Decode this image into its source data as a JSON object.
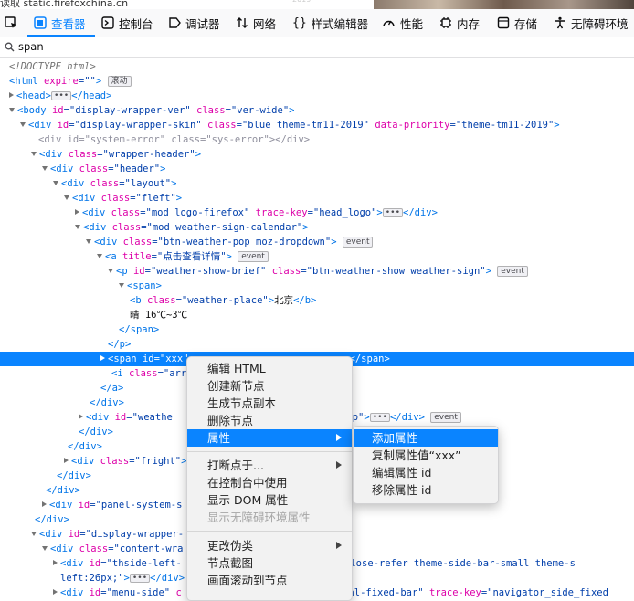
{
  "status": {
    "url": "读取 static.firefoxchina.cn",
    "faint_text": "2019"
  },
  "toolbar": {
    "tabs": [
      {
        "label": "查看器"
      },
      {
        "label": "控制台"
      },
      {
        "label": "调试器"
      },
      {
        "label": "网络"
      },
      {
        "label": "样式编辑器"
      },
      {
        "label": "性能"
      },
      {
        "label": "内存"
      },
      {
        "label": "存储"
      },
      {
        "label": "无障碍环境"
      }
    ]
  },
  "search": {
    "value": "span"
  },
  "tree": {
    "l0": {
      "t": "<!DOCTYPE html>"
    },
    "l1": {
      "a": "<html ",
      "b": "expire",
      "c": "=\"\"",
      "d": ">",
      "badge": "滚动"
    },
    "l2": {
      "a": "<head>",
      "b": "</head>"
    },
    "l3": {
      "a": "<body ",
      "b": "id",
      "c": "=\"display-wrapper-ver\" ",
      "d": "class",
      "e": "=\"ver-wide\"",
      "f": ">"
    },
    "l4": {
      "a": "<div ",
      "b": "id",
      "c": "=\"display-wrapper-skin\" ",
      "d": "class",
      "e": "=\"blue theme-tm11-2019\" ",
      "f": "data-priority",
      "g": "=\"theme-tm11-2019\"",
      "h": ">"
    },
    "l5": {
      "t": "<div id=\"system-error\" class=\"sys-error\"></div>"
    },
    "l6": {
      "a": "<div ",
      "b": "class",
      "c": "=\"wrapper-header\"",
      "d": ">"
    },
    "l7": {
      "a": "<div ",
      "b": "class",
      "c": "=\"header\"",
      "d": ">"
    },
    "l8": {
      "a": "<div ",
      "b": "class",
      "c": "=\"layout\"",
      "d": ">"
    },
    "l9": {
      "a": "<div ",
      "b": "class",
      "c": "=\"fleft\"",
      "d": ">"
    },
    "l10": {
      "a": "<div ",
      "b": "class",
      "c": "=\"mod logo-firefox\" ",
      "d": "trace-key",
      "e": "=\"head_logo\"",
      "f": ">",
      "g": "</div>"
    },
    "l11": {
      "a": "<div ",
      "b": "class",
      "c": "=\"mod weather-sign-calendar\"",
      "d": ">"
    },
    "l12": {
      "a": "<div ",
      "b": "class",
      "c": "=\"btn-weather-pop moz-dropdown\"",
      "d": ">",
      "badge": "event"
    },
    "l13": {
      "a": "<a ",
      "b": "title",
      "c": "=\"点击查看详情\"",
      "d": ">",
      "badge": "event"
    },
    "l14": {
      "a": "<p ",
      "b": "id",
      "c": "=\"weather-show-brief\" ",
      "d": "class",
      "e": "=\"btn-weather-show weather-sign\"",
      "f": ">",
      "badge": "event"
    },
    "l15": {
      "t": "<span>"
    },
    "l16": {
      "a": "<b ",
      "b": "class",
      "c": "=\"weather-place\"",
      "d": ">",
      "e": "北京",
      "f": "</b>"
    },
    "l17": {
      "t": "晴 16℃~3℃"
    },
    "l18": {
      "t": "</span>"
    },
    "l19": {
      "t": "</p>"
    },
    "l20": {
      "a": "<span ",
      "b": "id",
      "c": "=\"xxx\"",
      "d": "</span>"
    },
    "l21": {
      "a": "<i ",
      "b": "class",
      "c": "=\"arr"
    },
    "l22": {
      "t": "</a>"
    },
    "l23": {
      "t": "</div>"
    },
    "l24": {
      "a": "<div ",
      "b": "id",
      "c": "=\"weathe",
      "d": "r-show-pop\"",
      "e": ">",
      "f": "</div>",
      "badge": "event"
    },
    "l25": {
      "t": "</div>"
    },
    "l26": {
      "t": "</div>"
    },
    "l27": {
      "a": "<div ",
      "b": "class",
      "c": "=\"fright\"",
      "d": ">"
    },
    "l28": {
      "t": "</div>"
    },
    "l29": {
      "t": "</div>"
    },
    "l30": {
      "a": "<div ",
      "b": "id",
      "c": "=\"panel-system-s"
    },
    "l31": {
      "t": "</div>"
    },
    "l32": {
      "a": "<div ",
      "b": "id",
      "c": "=\"display-wrapper-"
    },
    "l33": {
      "a": "<div ",
      "b": "class",
      "c": "=\"content-wra"
    },
    "l34": {
      "a": "<div ",
      "b": "id",
      "c": "=\"thside-left-",
      "d": "ar pmt-close-refer theme-side-bar-small theme-s"
    },
    "l35": {
      "a": "left:26px;\"",
      "b": ">",
      "c": "</div>"
    },
    "l36": {
      "a": "<div ",
      "b": "id",
      "c": "=\"menu-side\" ",
      "d": "c",
      "e": "deal-fixed-bar\" ",
      "f": "trace-key",
      "g": "=\"navigator_side_fixed"
    }
  },
  "context_menu": {
    "items": [
      {
        "label": "编辑 HTML"
      },
      {
        "label": "创建新节点"
      },
      {
        "label": "生成节点副本"
      },
      {
        "label": "删除节点"
      },
      {
        "label": "属性"
      },
      {
        "label": "打断点于..."
      },
      {
        "label": "在控制台中使用"
      },
      {
        "label": "显示 DOM 属性"
      },
      {
        "label": "显示无障碍环境属性"
      },
      {
        "label": "更改伪类"
      },
      {
        "label": "节点截图"
      },
      {
        "label": "画面滚动到节点"
      }
    ],
    "submenu": [
      {
        "label": "添加属性"
      },
      {
        "label": "复制属性值“xxx”"
      },
      {
        "label": "编辑属性 id"
      },
      {
        "label": "移除属性 id"
      }
    ]
  }
}
